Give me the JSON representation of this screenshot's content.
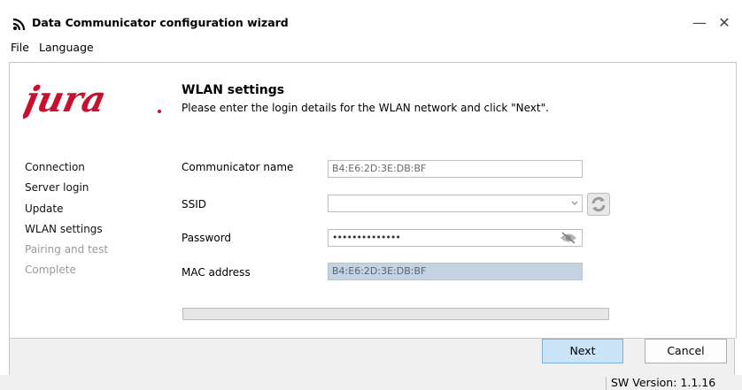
{
  "window": {
    "title": "Data Communicator configuration wizard",
    "minimize_glyph": "—",
    "close_glyph": "✕"
  },
  "menu": {
    "items": [
      "File",
      "Language"
    ]
  },
  "logo": {
    "text": "jura",
    "color": "#c8102e"
  },
  "header": {
    "title": "WLAN settings",
    "subtitle": "Please enter the login details for the WLAN network and click \"Next\"."
  },
  "steps": [
    {
      "label": "Connection",
      "state": "done"
    },
    {
      "label": "Server login",
      "state": "done"
    },
    {
      "label": "Update",
      "state": "done"
    },
    {
      "label": "WLAN settings",
      "state": "current"
    },
    {
      "label": "Pairing and test",
      "state": "pending"
    },
    {
      "label": "Complete",
      "state": "pending"
    }
  ],
  "form": {
    "communicator_name": {
      "label": "Communicator name",
      "value": "B4:E6:2D:3E:DB:BF"
    },
    "ssid": {
      "label": "SSID",
      "value": ""
    },
    "password": {
      "label": "Password",
      "value": "••••••••••••••"
    },
    "mac_address": {
      "label": "MAC address",
      "value": "B4:E6:2D:3E:DB:BF"
    }
  },
  "buttons": {
    "next": "Next",
    "cancel": "Cancel"
  },
  "status": {
    "version": "SW Version:  1.1.16"
  },
  "icons": {
    "wifi": "wifi-icon",
    "refresh": "refresh-icon",
    "eye": "show-password-icon",
    "dropdown": "chevron-down-icon"
  }
}
